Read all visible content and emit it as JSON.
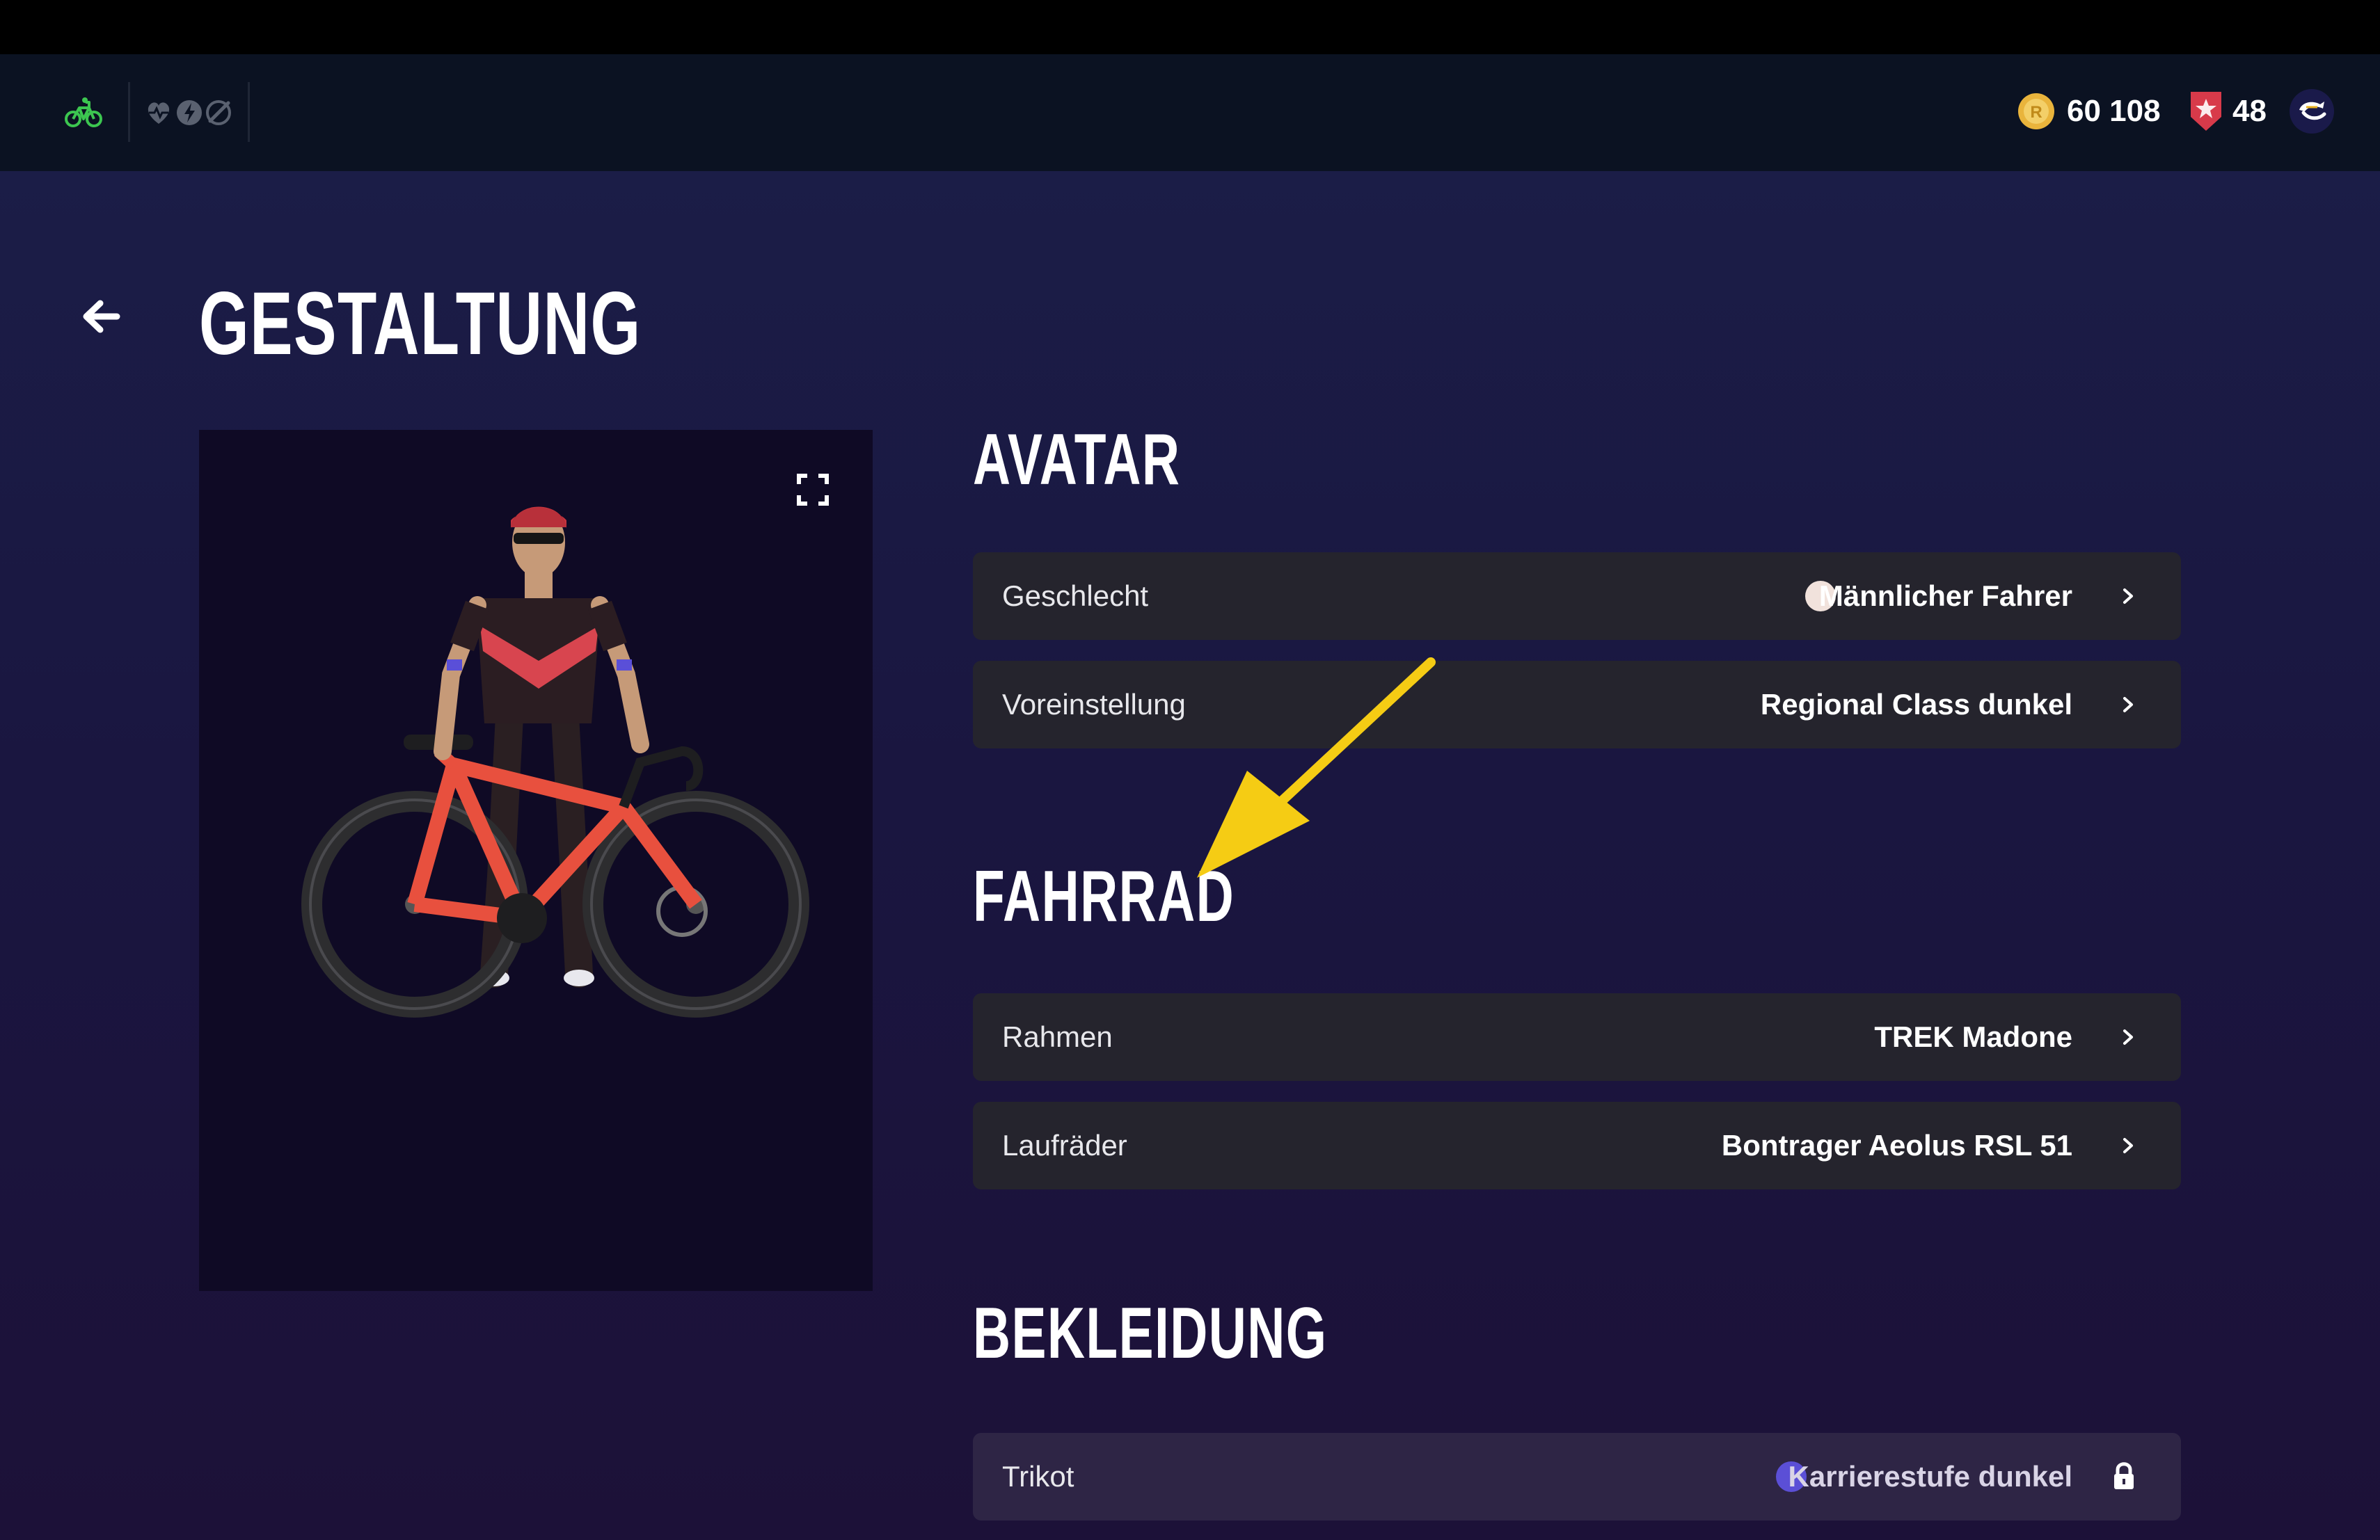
{
  "header": {
    "coins": "60 108",
    "level": "48",
    "icons": [
      "bike-icon",
      "heart-rate-icon",
      "power-icon",
      "cadence-icon",
      "coin-icon",
      "level-shield-icon",
      "profile-avatar-icon"
    ]
  },
  "page": {
    "title": "GESTALTUNG",
    "back_icon": "arrow-left-icon"
  },
  "preview": {
    "expand_icon": "fullscreen-icon"
  },
  "sections": {
    "avatar": {
      "title": "AVATAR",
      "rows": [
        {
          "label": "Geschlecht",
          "value": "Männlicher Fahrer",
          "dot_color": "#f1e2dc"
        },
        {
          "label": "Voreinstellung",
          "value": "Regional Class dunkel"
        }
      ]
    },
    "bike": {
      "title": "FAHRRAD",
      "rows": [
        {
          "label": "Rahmen",
          "value": "TREK Madone"
        },
        {
          "label": "Laufräder",
          "value": "Bontrager Aeolus RSL 51"
        }
      ]
    },
    "clothing": {
      "title": "BEKLEIDUNG",
      "rows": [
        {
          "label": "Trikot",
          "value": "Karrierestufe dunkel",
          "dot_color": "#5b4fd6",
          "locked": true
        }
      ]
    }
  },
  "colors": {
    "accent_green": "#3cc650",
    "coin_gold": "#e9b43c",
    "shield_red": "#d83a4a",
    "annotation_yellow": "#f5cc14"
  }
}
